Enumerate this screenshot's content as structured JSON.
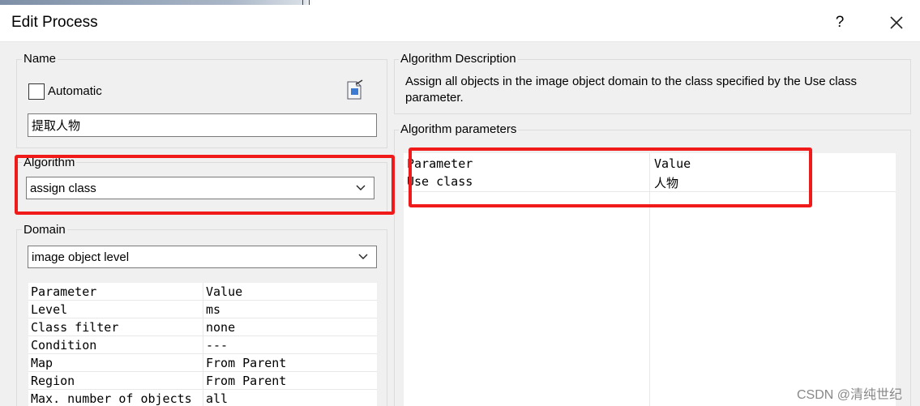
{
  "window": {
    "title": "Edit Process",
    "help_label": "?",
    "close_label": "×"
  },
  "name_group": {
    "label": "Name",
    "automatic_label": "Automatic",
    "name_value": "提取人物"
  },
  "algorithm_group": {
    "label": "Algorithm",
    "selected": "assign class"
  },
  "domain_group": {
    "label": "Domain",
    "selected": "image object level",
    "table": {
      "headers": [
        "Parameter",
        "Value"
      ],
      "rows": [
        [
          "Level",
          "ms"
        ],
        [
          "Class filter",
          "none"
        ],
        [
          "Condition",
          "---"
        ],
        [
          "Map",
          "From Parent"
        ],
        [
          "Region",
          "From Parent"
        ],
        [
          "Max. number of objects",
          "all"
        ]
      ]
    }
  },
  "description_group": {
    "label": "Algorithm Description",
    "text": "Assign all objects in the image object domain to the class specified by the Use class parameter."
  },
  "parameters_group": {
    "label": "Algorithm parameters",
    "table": {
      "headers": [
        "Parameter",
        "Value"
      ],
      "rows": [
        [
          "Use class",
          "人物"
        ]
      ]
    }
  },
  "watermark": "CSDN @清纯世纪",
  "colors": {
    "highlight": "#f01a1a",
    "dialog_bg": "#f0f0f0"
  }
}
